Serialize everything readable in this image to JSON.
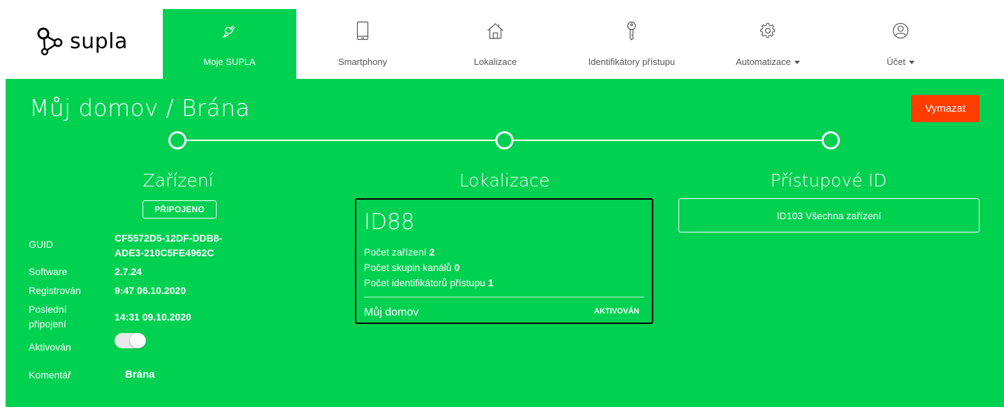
{
  "brand": {
    "name": "supla"
  },
  "nav": [
    {
      "label": "Moje SUPLA",
      "icon": "plug-icon",
      "active": true
    },
    {
      "label": "Smartphony",
      "icon": "smartphone-icon",
      "active": false
    },
    {
      "label": "Lokalizace",
      "icon": "home-icon",
      "active": false
    },
    {
      "label": "Identifikátory přístupu",
      "icon": "key-icon",
      "active": false
    },
    {
      "label": "Automatizace",
      "icon": "gear-icon",
      "active": false,
      "dropdown": true
    },
    {
      "label": "Účet",
      "icon": "user-icon",
      "active": false,
      "dropdown": true
    }
  ],
  "page": {
    "title": "Můj domov / Brána",
    "delete_label": "Vymazat"
  },
  "columns": {
    "device": "Zařízení",
    "location": "Lokalizace",
    "access": "Přístupové ID"
  },
  "device": {
    "status": "PŘIPOJENO",
    "guid_label": "GUID",
    "guid_line1": "CF5572D5-12DF-DDB8-",
    "guid_line2": "ADE3-210C5FE4962C",
    "software_label": "Software",
    "software": "2.7.24",
    "registered_label": "Registrován",
    "registered": "9:47 06.10.2020",
    "last_conn_label_1": "Poslední",
    "last_conn_label_2": "připojení",
    "last_conn": "14:31 09.10.2020",
    "enabled_label": "Aktivován",
    "enabled": true,
    "comment_label": "Komentář",
    "comment": "Brána"
  },
  "location_card": {
    "id": "ID88",
    "devices_label": "Počet zařízení",
    "devices": "2",
    "groups_label": "Počet skupin kanálů",
    "groups": "0",
    "aids_label": "Počet identifikátorů přístupu",
    "aids": "1",
    "name": "Můj domov",
    "status": "AKTIVOVÁN"
  },
  "access_id": {
    "label": "ID103 Všechna zařízení"
  },
  "colors": {
    "brand_green": "#00d151",
    "danger": "#ff3d00",
    "white": "#ffffff"
  }
}
